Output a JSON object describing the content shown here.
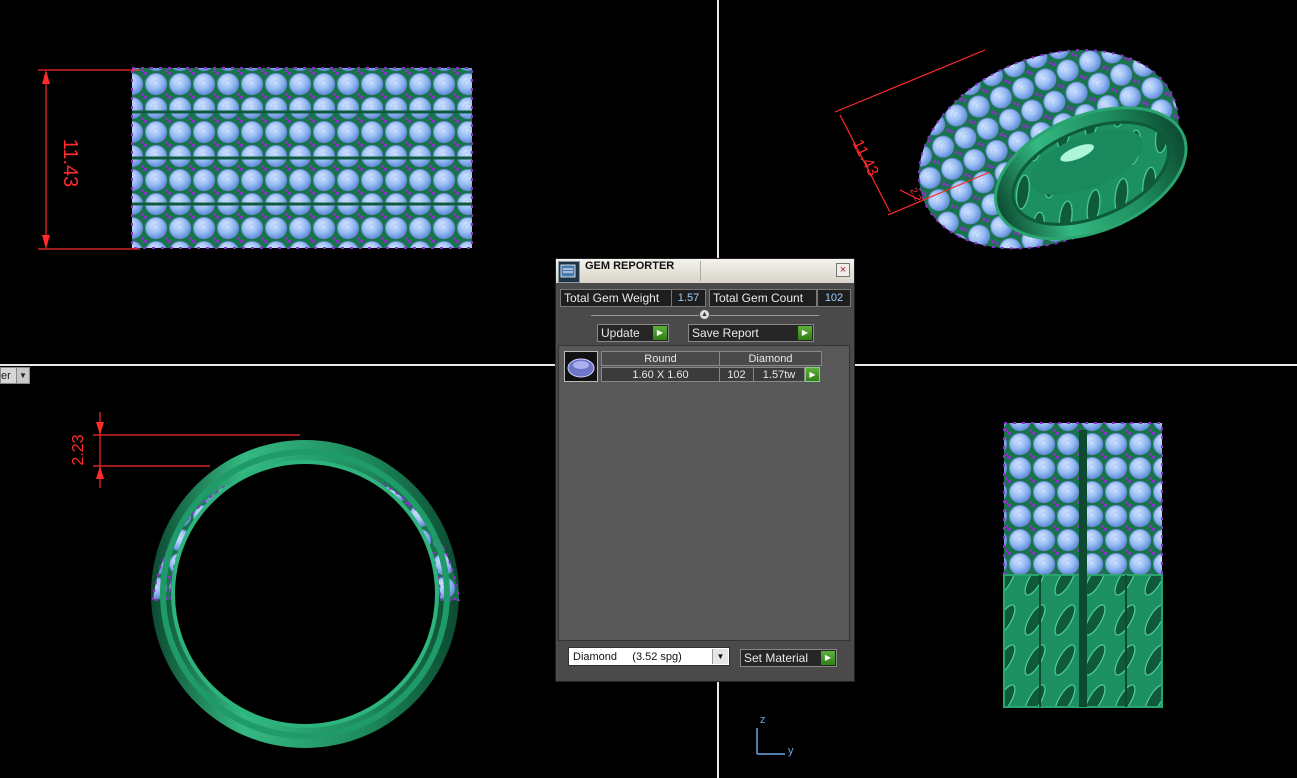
{
  "viewports": {
    "front": {
      "dimension": "11.43"
    },
    "perspective": {
      "dimension": "11.43",
      "small_dimension": "2.2"
    },
    "side": {
      "dimension": "2.23"
    },
    "top": {}
  },
  "viewport_label": "er",
  "axes": {
    "z": "z",
    "y": "y"
  },
  "dialog": {
    "title": "GEM REPORTER",
    "close_icon": "×",
    "total_weight_label": "Total Gem Weight",
    "total_weight_value": "1.57",
    "total_count_label": "Total Gem Count",
    "total_count_value": "102",
    "update_label": "Update",
    "save_report_label": "Save Report",
    "gem_row": {
      "shape": "Round",
      "material": "Diamond",
      "size": "1.60 X 1.60",
      "count": "102",
      "weight": "1.57tw"
    },
    "material_select": "Diamond     (3.52 spg)",
    "set_material_label": "Set Material"
  },
  "colors": {
    "metal": "#1a8a5e",
    "gem": "#8fb6f2",
    "prong": "#8a30c8",
    "dimension": "#ff2a2a"
  }
}
